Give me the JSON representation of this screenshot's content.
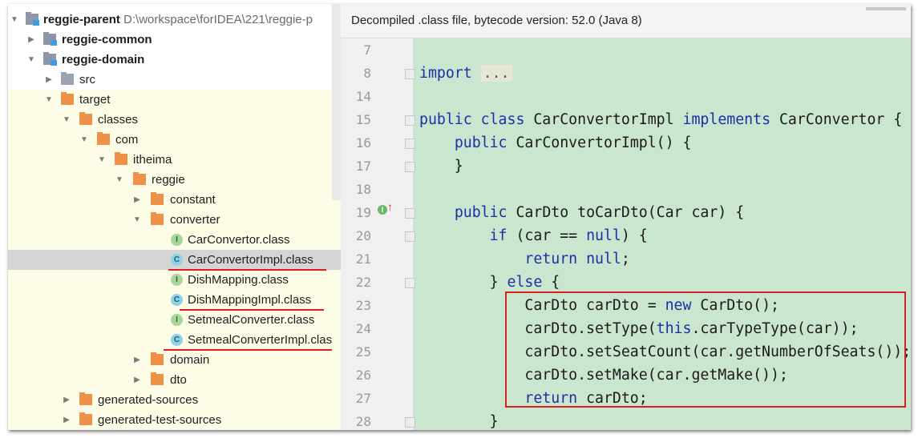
{
  "tree": {
    "rows": [
      {
        "label": "reggie-parent",
        "path": "D:\\workspace\\forIDEA\\221\\reggie-p"
      },
      {
        "label": "reggie-common"
      },
      {
        "label": "reggie-domain"
      },
      {
        "label": "src"
      },
      {
        "label": "target"
      },
      {
        "label": "classes"
      },
      {
        "label": "com"
      },
      {
        "label": "itheima"
      },
      {
        "label": "reggie"
      },
      {
        "label": "constant"
      },
      {
        "label": "converter"
      },
      {
        "label": "CarConvertor.class",
        "icon_letter": "I"
      },
      {
        "label": "CarConvertorImpl.class",
        "icon_letter": "C"
      },
      {
        "label": "DishMapping.class",
        "icon_letter": "I"
      },
      {
        "label": "DishMappingImpl.class",
        "icon_letter": "C"
      },
      {
        "label": "SetmealConverter.class",
        "icon_letter": "I"
      },
      {
        "label": "SetmealConverterImpl.clas",
        "icon_letter": "C"
      },
      {
        "label": "domain"
      },
      {
        "label": "dto"
      },
      {
        "label": "generated-sources"
      },
      {
        "label": "generated-test-sources"
      }
    ]
  },
  "editor": {
    "banner": "Decompiled .class file, bytecode version: 52.0 (Java 8)",
    "lines": [
      {
        "num": "7",
        "text": ""
      },
      {
        "num": "8",
        "text": "import ..."
      },
      {
        "num": "14",
        "text": ""
      },
      {
        "num": "15",
        "text": "public class CarConvertorImpl implements CarConvertor {"
      },
      {
        "num": "16",
        "text": "    public CarConvertorImpl() {"
      },
      {
        "num": "17",
        "text": "    }"
      },
      {
        "num": "18",
        "text": ""
      },
      {
        "num": "19",
        "text": "    public CarDto toCarDto(Car car) {"
      },
      {
        "num": "20",
        "text": "        if (car == null) {"
      },
      {
        "num": "21",
        "text": "            return null;"
      },
      {
        "num": "22",
        "text": "        } else {"
      },
      {
        "num": "23",
        "text": "            CarDto carDto = new CarDto();"
      },
      {
        "num": "24",
        "text": "            carDto.setType(this.carTypeType(car));"
      },
      {
        "num": "25",
        "text": "            carDto.setSeatCount(car.getNumberOfSeats());"
      },
      {
        "num": "26",
        "text": "            carDto.setMake(car.getMake());"
      },
      {
        "num": "27",
        "text": "            return carDto;"
      },
      {
        "num": "28",
        "text": "        }"
      }
    ],
    "gutter_icon_letter": "I",
    "gutter_arrow": "↑"
  },
  "icons": {
    "expanded": "chevron-down-icon",
    "collapsed": "chevron-right-icon",
    "module": "module-icon",
    "folder": "folder-icon",
    "interface_class": "interface-class-icon",
    "class": "class-icon"
  },
  "colors": {
    "editor_bg": "#cbe6ce",
    "keyword": "#1b2fa8",
    "highlight_box": "#d52020",
    "tree_selected": "#d5d5d5",
    "folder_orange": "#f0914a",
    "tree_excluded_bg": "#fdfce6"
  }
}
